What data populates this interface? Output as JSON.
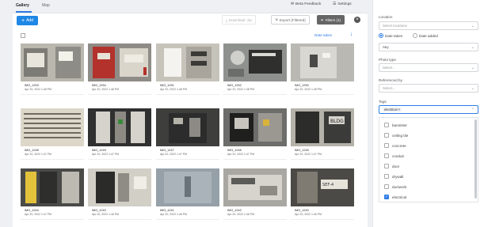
{
  "tabs": [
    "Gallery",
    "Map"
  ],
  "toolbar": {
    "add_label": "Add",
    "download_label": "Download .zip",
    "export_label": "Export (Filtered)",
    "filters_label": "Filters (1)"
  },
  "sort_label": "Date taken",
  "photos": [
    {
      "name": "IMG_1253",
      "date": "Apr 20, 2022 1:48 PM"
    },
    {
      "name": "IMG_1254",
      "date": "Apr 20, 2022 1:48 PM"
    },
    {
      "name": "IMG_1251",
      "date": "Apr 20, 2022 1:48 PM"
    },
    {
      "name": "IMG_1252",
      "date": "Apr 20, 2022 1:48 PM"
    },
    {
      "name": "IMG_1250",
      "date": "Apr 20, 2022 1:48 PM"
    },
    {
      "name": "IMG_1248",
      "date": "Apr 20, 2022 1:47 PM"
    },
    {
      "name": "IMG_1249",
      "date": "Apr 20, 2022 1:47 PM"
    },
    {
      "name": "IMG_1247",
      "date": "Apr 20, 2022 1:47 PM"
    },
    {
      "name": "IMG_1246",
      "date": "Apr 20, 2022 1:47 PM"
    },
    {
      "name": "IMG_1245",
      "date": "Apr 20, 2022 1:47 PM"
    },
    {
      "name": "IMG_1244",
      "date": "Apr 20, 2022 1:47 PM"
    },
    {
      "name": "IMG_1243",
      "date": "Apr 20, 2022 1:46 PM"
    },
    {
      "name": "IMG_1241",
      "date": "Apr 20, 2022 1:46 PM"
    },
    {
      "name": "IMG_1242",
      "date": "Apr 20, 2022 1:46 PM"
    },
    {
      "name": "IMG_1240",
      "date": "Apr 20, 2022 1:46 PM"
    }
  ],
  "side": {
    "beta_feedback": "Beta Feedback",
    "settings": "Settings",
    "location_label": "Location",
    "location_placeholder": "Select locations",
    "date_taken": "Date taken",
    "date_added": "Date added",
    "date_value": "Any",
    "photo_type_label": "Photo type",
    "photo_type_placeholder": "Select...",
    "referenced_by_label": "Referenced by",
    "referenced_by_placeholder": "Select...",
    "tags_label": "Tags",
    "tag_chip": "electrical",
    "tag_options": [
      {
        "label": "bannister",
        "checked": false
      },
      {
        "label": "ceiling tile",
        "checked": false
      },
      {
        "label": "concrete",
        "checked": false
      },
      {
        "label": "conduit",
        "checked": false
      },
      {
        "label": "door",
        "checked": false
      },
      {
        "label": "drywall",
        "checked": false
      },
      {
        "label": "ductwork",
        "checked": false
      },
      {
        "label": "electrical",
        "checked": true
      }
    ]
  }
}
